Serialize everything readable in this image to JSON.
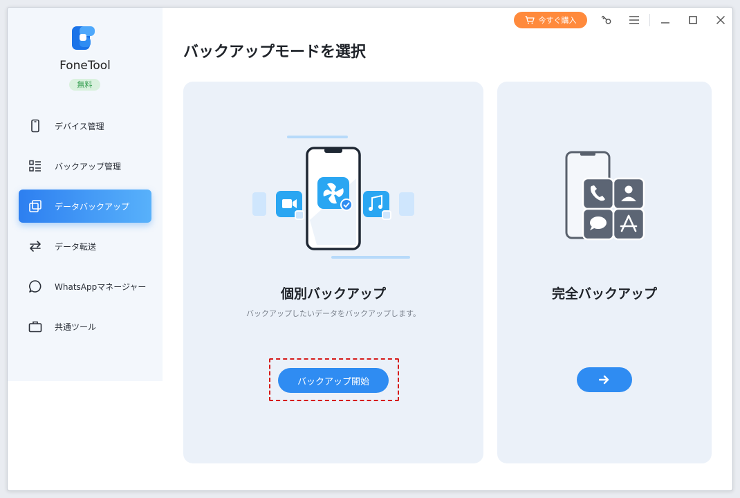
{
  "app": {
    "name": "FoneTool",
    "plan_badge": "無料"
  },
  "titlebar": {
    "buy_label": "今すぐ購入",
    "icons": [
      "cart-icon",
      "key-icon",
      "menu-icon",
      "minimize-icon",
      "maximize-icon",
      "close-icon"
    ]
  },
  "sidebar": {
    "items": [
      {
        "label": "デバイス管理",
        "icon": "phone-icon",
        "active": false
      },
      {
        "label": "バックアップ管理",
        "icon": "list-icon",
        "active": false
      },
      {
        "label": "データバックアップ",
        "icon": "copy-icon",
        "active": true
      },
      {
        "label": "データ転送",
        "icon": "transfer-icon",
        "active": false
      },
      {
        "label": "WhatsAppマネージャー",
        "icon": "chat-icon",
        "active": false
      },
      {
        "label": "共通ツール",
        "icon": "toolbox-icon",
        "active": false
      }
    ]
  },
  "main": {
    "title": "バックアップモードを選択",
    "cards": [
      {
        "title": "個別バックアップ",
        "description": "バックアップしたいデータをバックアップします。",
        "button_label": "バックアップ開始"
      },
      {
        "title": "完全バックアップ",
        "description": "",
        "button_label": "→"
      }
    ]
  },
  "colors": {
    "accent": "#2f8cf2",
    "buy": "#ff8a3c",
    "card_bg": "#ebf1f9",
    "highlight": "#d61a1a"
  }
}
